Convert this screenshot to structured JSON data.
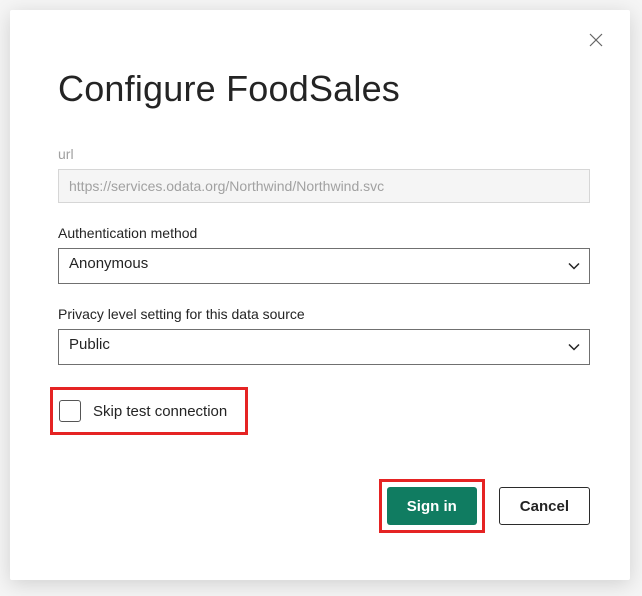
{
  "dialog": {
    "title": "Configure FoodSales",
    "url": {
      "label": "url",
      "value": "https://services.odata.org/Northwind/Northwind.svc"
    },
    "auth": {
      "label": "Authentication method",
      "value": "Anonymous"
    },
    "privacy": {
      "label": "Privacy level setting for this data source",
      "value": "Public"
    },
    "skip_test": {
      "label": "Skip test connection"
    },
    "buttons": {
      "primary": "Sign in",
      "secondary": "Cancel"
    }
  }
}
